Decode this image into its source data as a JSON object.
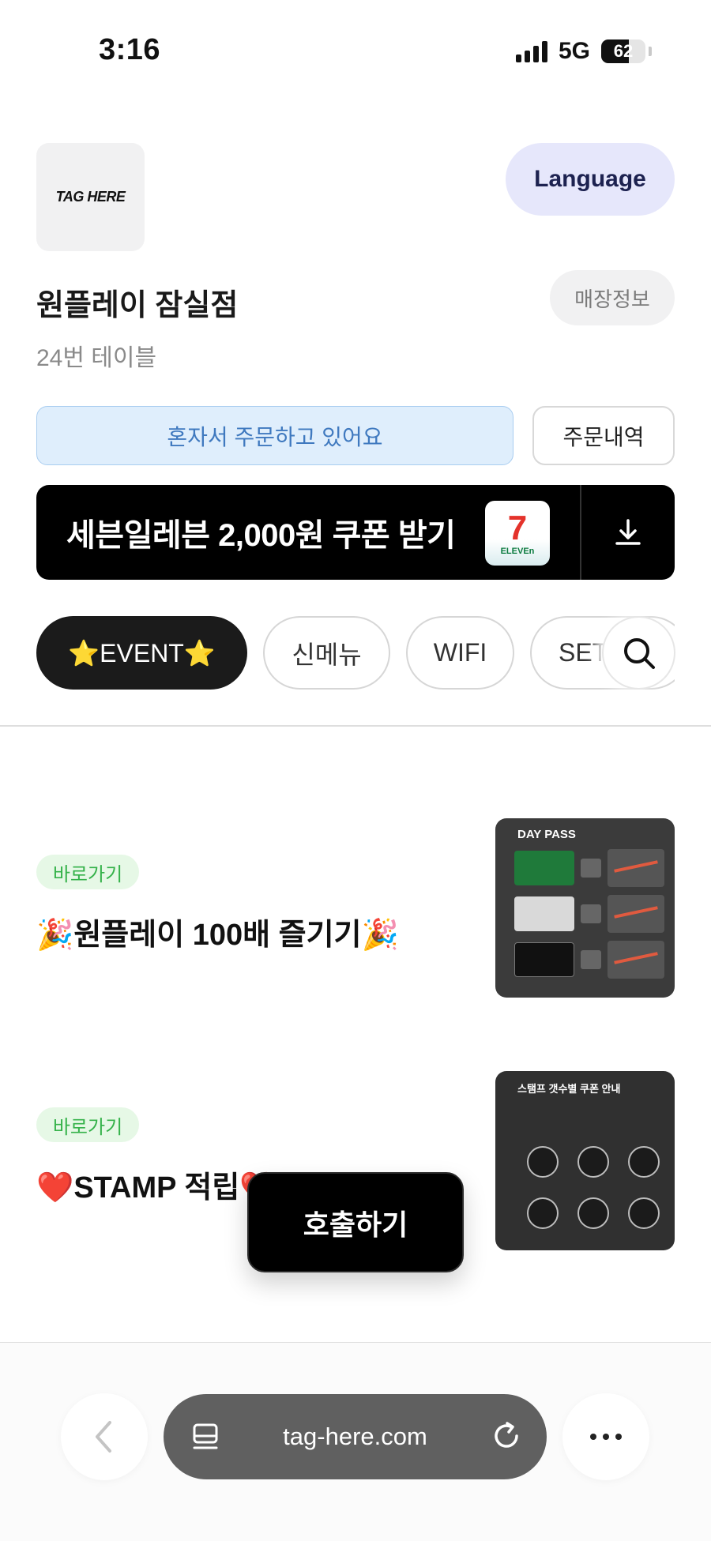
{
  "status_bar": {
    "time": "3:16",
    "network": "5G",
    "battery": "62",
    "battery_level": 0.62
  },
  "header": {
    "logo_text": "TAG HERE",
    "language_label": "Language",
    "store_name": "원플레이 잠실점",
    "store_info_label": "매장정보",
    "table_label": "24번 테이블"
  },
  "order": {
    "solo_label": "혼자서 주문하고 있어요",
    "history_label": "주문내역"
  },
  "coupon": {
    "text": "세븐일레븐 2,000원 쿠폰 받기",
    "logo_mark": "7",
    "logo_label": "ELEVEn"
  },
  "categories": [
    "⭐EVENT⭐",
    "신메뉴",
    "WIFI",
    "SET"
  ],
  "menu_items": [
    {
      "badge": "바로가기",
      "title": "🎉원플레이 100배 즐기기🎉",
      "thumb_heading": "DAY PASS"
    },
    {
      "badge": "바로가기",
      "title": "❤️STAMP 적립❤️",
      "thumb_heading": "스탬프 갯수별 쿠폰 안내"
    }
  ],
  "call_label": "호출하기",
  "browser": {
    "url": "tag-here.com"
  },
  "colors": {
    "accent_blue": "#3f79bf",
    "badge_green": "#35b24a",
    "language_bg": "#e6e7fb"
  }
}
